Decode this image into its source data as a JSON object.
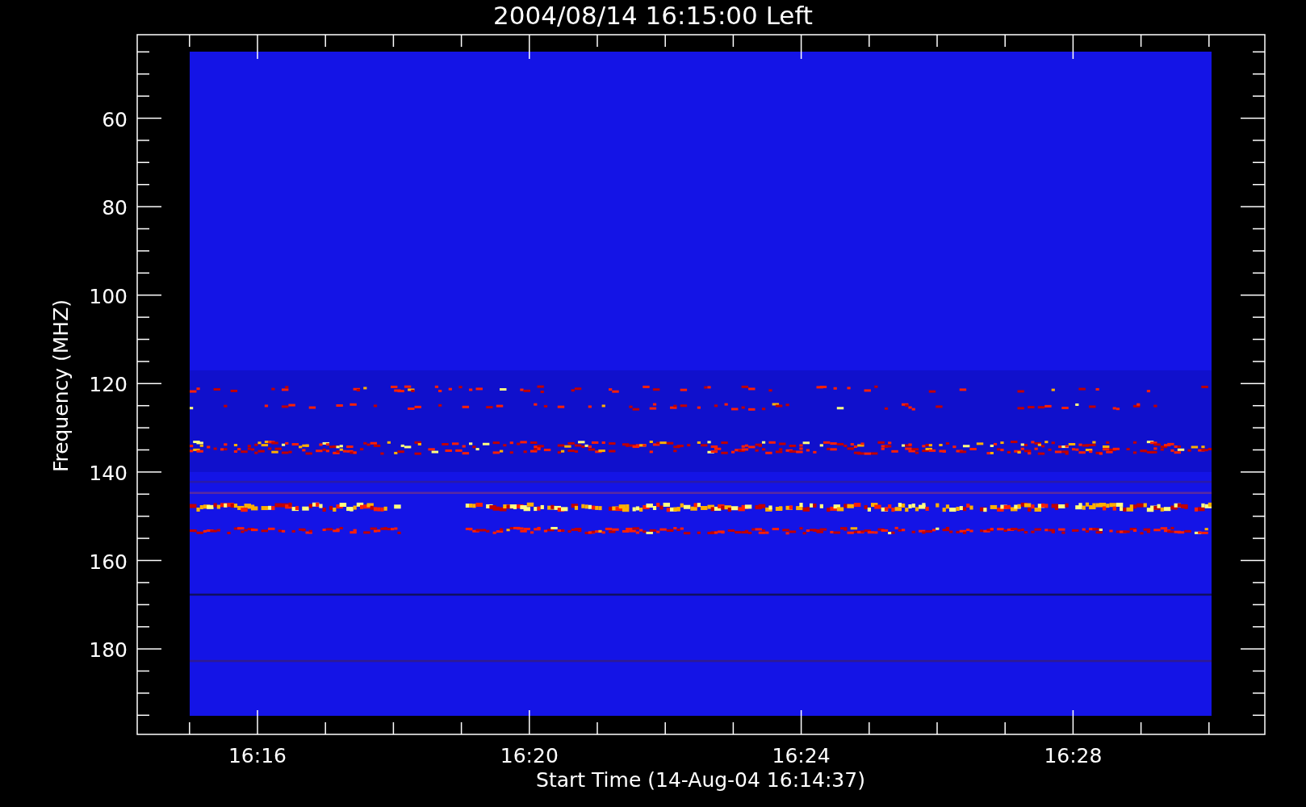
{
  "title": "2004/08/14 16:15:00 Left",
  "y_axis": {
    "title": "Frequency (MHZ)",
    "labels": [
      "60",
      "80",
      "100",
      "120",
      "140",
      "160",
      "180"
    ]
  },
  "x_axis": {
    "title": "Start Time (14-Aug-04 16:14:37)",
    "labels": [
      "16:16",
      "16:20",
      "16:24",
      "16:28"
    ]
  }
}
